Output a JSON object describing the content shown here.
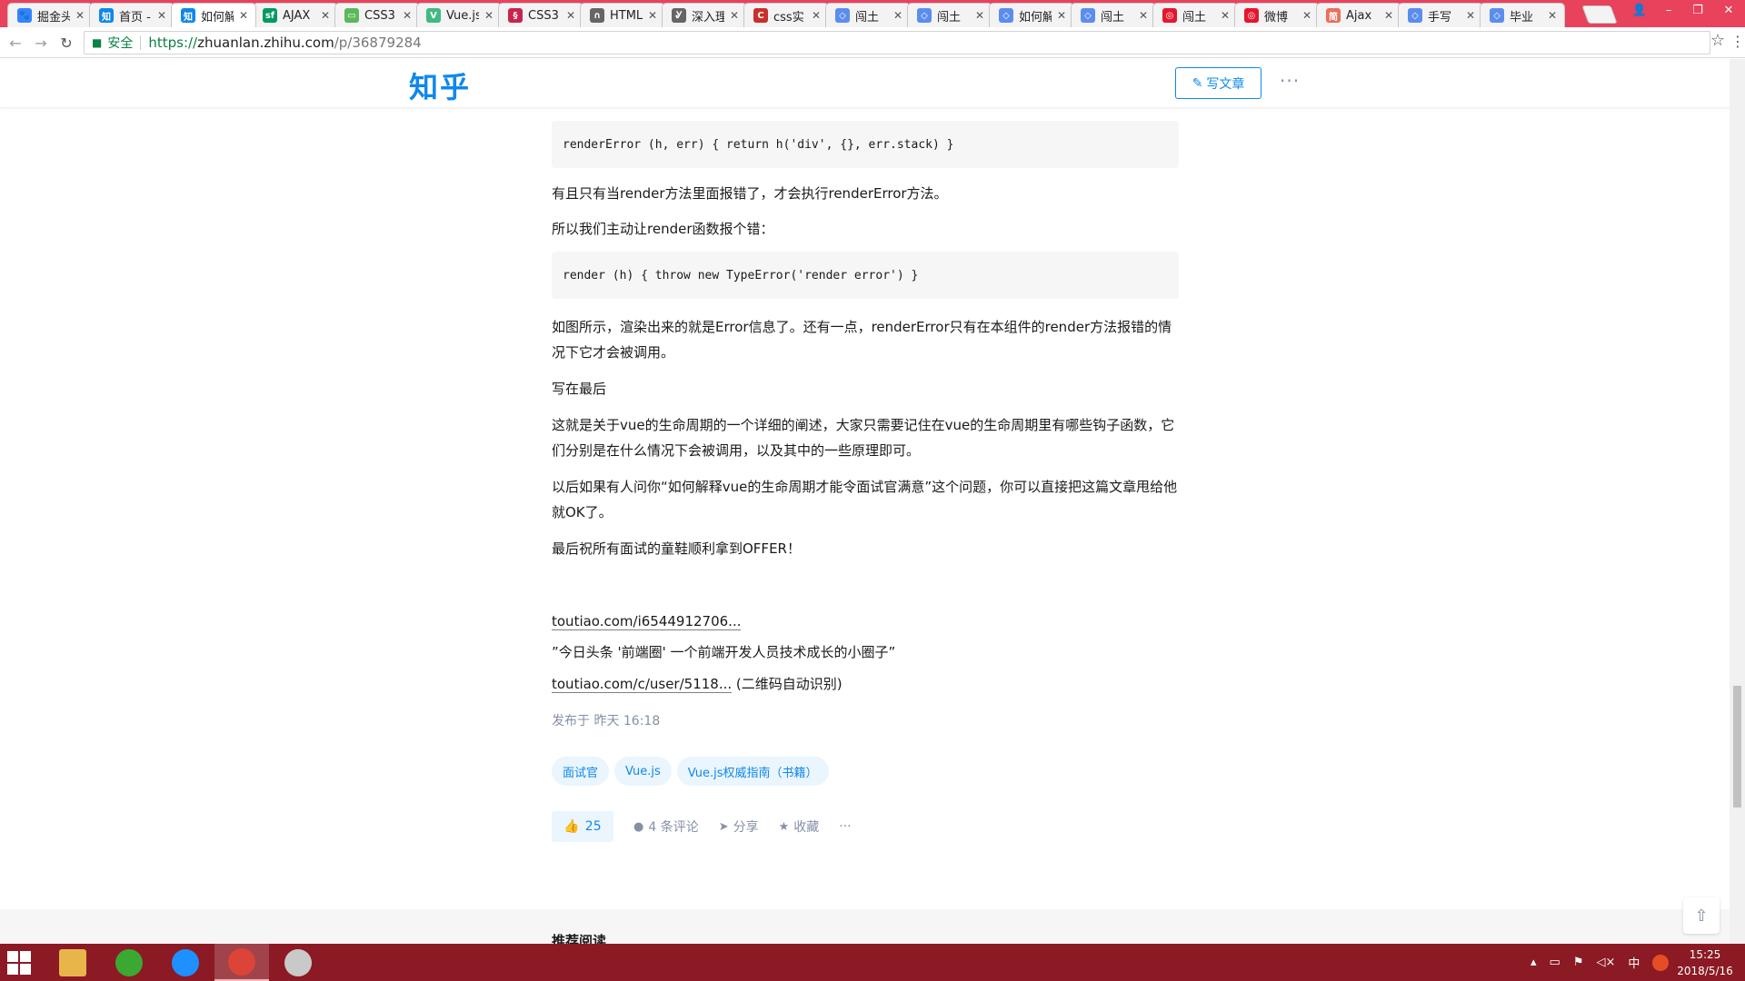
{
  "browser": {
    "tabs": [
      {
        "title": "掘金头",
        "favicon": "paw-icon",
        "color": "#3385ff",
        "glyph": "🐾"
      },
      {
        "title": "首页 -",
        "favicon": "zhihu-icon",
        "color": "#0f88eb",
        "glyph": "知"
      },
      {
        "title": "如何解",
        "favicon": "zhihu-icon",
        "color": "#0f88eb",
        "glyph": "知",
        "active": true
      },
      {
        "title": "AJAX",
        "favicon": "segmentfault-icon",
        "color": "#009a61",
        "glyph": "sf"
      },
      {
        "title": "CSS3",
        "favicon": "book-icon",
        "color": "#5cb85c",
        "glyph": "▭"
      },
      {
        "title": "Vue.js",
        "favicon": "vue-icon",
        "color": "#42b983",
        "glyph": "V"
      },
      {
        "title": "CSS3",
        "favicon": "css-icon",
        "color": "#c7254e",
        "glyph": "§"
      },
      {
        "title": "HTML",
        "favicon": "html-icon",
        "color": "#666666",
        "glyph": "∩"
      },
      {
        "title": "深入理",
        "favicon": "search-icon",
        "color": "#666666",
        "glyph": "Ꮍ"
      },
      {
        "title": "css实",
        "favicon": "csdn-icon",
        "color": "#c9302c",
        "glyph": "C"
      },
      {
        "title": "闯土",
        "favicon": "jianshu-icon",
        "color": "#5b8def",
        "glyph": "◇"
      },
      {
        "title": "闯土",
        "favicon": "jianshu-icon",
        "color": "#5b8def",
        "glyph": "◇"
      },
      {
        "title": "如何解",
        "favicon": "jianshu-icon",
        "color": "#5b8def",
        "glyph": "◇"
      },
      {
        "title": "闯土",
        "favicon": "jianshu-icon",
        "color": "#5b8def",
        "glyph": "◇"
      },
      {
        "title": "闯土",
        "favicon": "weibo-icon",
        "color": "#e6162d",
        "glyph": "◎"
      },
      {
        "title": "微博",
        "favicon": "weibo-icon",
        "color": "#e6162d",
        "glyph": "◎"
      },
      {
        "title": "Ajax",
        "favicon": "jianshu-icon",
        "color": "#ea6f5a",
        "glyph": "简"
      },
      {
        "title": "手写",
        "favicon": "jianshu-icon",
        "color": "#5b8def",
        "glyph": "◇"
      },
      {
        "title": "毕业",
        "favicon": "jianshu-icon",
        "color": "#5b8def",
        "glyph": "◇"
      }
    ],
    "secure_label": "安全",
    "url": {
      "scheme": "https://",
      "host": "zhuanlan.zhihu.com",
      "path": "/p/36879284"
    }
  },
  "header": {
    "logo": "知乎",
    "write_button": "写文章",
    "more": "···"
  },
  "article": {
    "blocks": [
      {
        "type": "code",
        "text": "renderError (h, err) { return h('div', {}, err.stack) }"
      },
      {
        "type": "p",
        "text": "有且只有当render方法里面报错了，才会执行renderError方法。"
      },
      {
        "type": "p",
        "text": "所以我们主动让render函数报个错："
      },
      {
        "type": "code",
        "text": "render (h) { throw new TypeError('render error') }"
      },
      {
        "type": "p",
        "text": "如图所示，渲染出来的就是Error信息了。还有一点，renderError只有在本组件的render方法报错的情况下它才会被调用。"
      },
      {
        "type": "p",
        "text": "写在最后"
      },
      {
        "type": "p",
        "text": "这就是关于vue的生命周期的一个详细的阐述，大家只需要记住在vue的生命周期里有哪些钩子函数，它们分别是在什么情况下会被调用，以及其中的一些原理即可。"
      },
      {
        "type": "p",
        "text": "以后如果有人问你“如何解释vue的生命周期才能令面试官满意”这个问题，你可以直接把这篇文章甩给他就OK了。"
      },
      {
        "type": "p",
        "text": "最后祝所有面试的童鞋顺利拿到OFFER！"
      }
    ],
    "link1": "toutiao.com/i6544912706...",
    "promo": "”今日头条 '前端圈' 一个前端开发人员技术成长的小圈子”",
    "link2": "toutiao.com/c/user/5118...",
    "link2_suffix": " (二维码自动识别)",
    "published": "发布于 昨天 16:18",
    "tags": [
      "面试官",
      "Vue.js",
      "Vue.js权威指南（书籍）"
    ],
    "actions": {
      "likes": "25",
      "comments": "4 条评论",
      "share": "分享",
      "collect": "收藏",
      "more": "···"
    },
    "recommend_title": "推荐阅读"
  },
  "taskbar": {
    "apps": [
      {
        "name": "file-explorer-icon",
        "color": "#e8b54a"
      },
      {
        "name": "green-app-icon",
        "color": "#3aa831"
      },
      {
        "name": "blue-app-icon",
        "color": "#1e90ff"
      },
      {
        "name": "chrome-icon",
        "color": "#db4437",
        "active": true
      },
      {
        "name": "paint-icon",
        "color": "#c9c9c9"
      }
    ],
    "ime": "中",
    "time": "15:25",
    "date": "2018/5/16"
  }
}
